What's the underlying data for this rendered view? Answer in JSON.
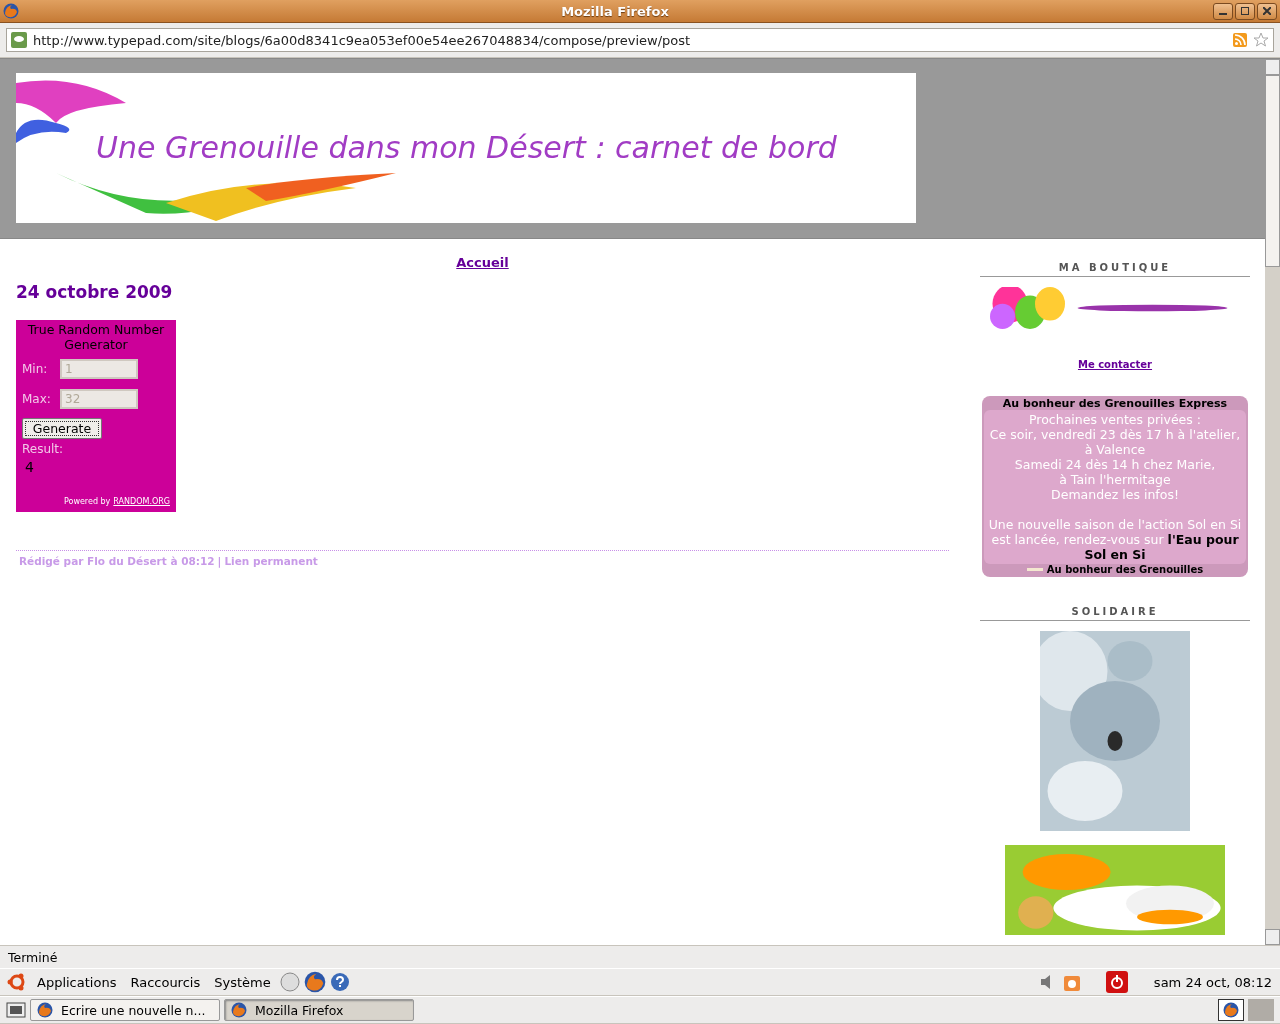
{
  "window": {
    "title": "Mozilla Firefox"
  },
  "address_bar": {
    "url": "http://www.typepad.com/site/blogs/6a00d8341c9ea053ef00e54ee267048834/compose/preview/post"
  },
  "blog": {
    "title": "Une Grenouille dans mon Désert : carnet de bord",
    "nav_link": "Accueil",
    "post": {
      "date": "24 octobre 2009",
      "widget": {
        "title": "True Random Number Generator",
        "min_label": "Min:",
        "min_value": "1",
        "max_label": "Max:",
        "max_value": "32",
        "button": "Generate",
        "result_label": "Result:",
        "result": "4",
        "powered_by": "Powered by",
        "powered_link": "RANDOM.ORG"
      },
      "footer": {
        "byline": "Rédigé par Flo du Désert à 08:12",
        "separator": "|",
        "permalink": "Lien permanent"
      }
    },
    "sidebar": {
      "boutique": {
        "heading": "MA BOUTIQUE",
        "contact_link": "Me contacter"
      },
      "express": {
        "title": "Au bonheur des Grenouilles Express",
        "lines": [
          "Prochaines ventes privées :",
          "Ce soir, vendredi 23 dès 17 h à l'atelier,",
          "à Valence",
          "Samedi 24 dès 14 h chez Marie,",
          "à Tain l'hermitage",
          "Demandez les infos!"
        ],
        "news": "Une nouvelle saison de l'action Sol en Si est lancée, rendez-vous sur **l'Eau pour Sol en Si**",
        "footer": "Au bonheur des Grenouilles"
      },
      "solidaire": {
        "heading": "SOLIDAIRE"
      }
    }
  },
  "status_bar": {
    "text": "Terminé"
  },
  "top_panel": {
    "menus": [
      "Applications",
      "Raccourcis",
      "Système"
    ],
    "clock": "sam 24 oct, 08:12"
  },
  "taskbar": {
    "items": [
      {
        "label": "Ecrire une nouvelle n...",
        "selected": false
      },
      {
        "label": "Mozilla Firefox",
        "selected": true
      }
    ]
  }
}
